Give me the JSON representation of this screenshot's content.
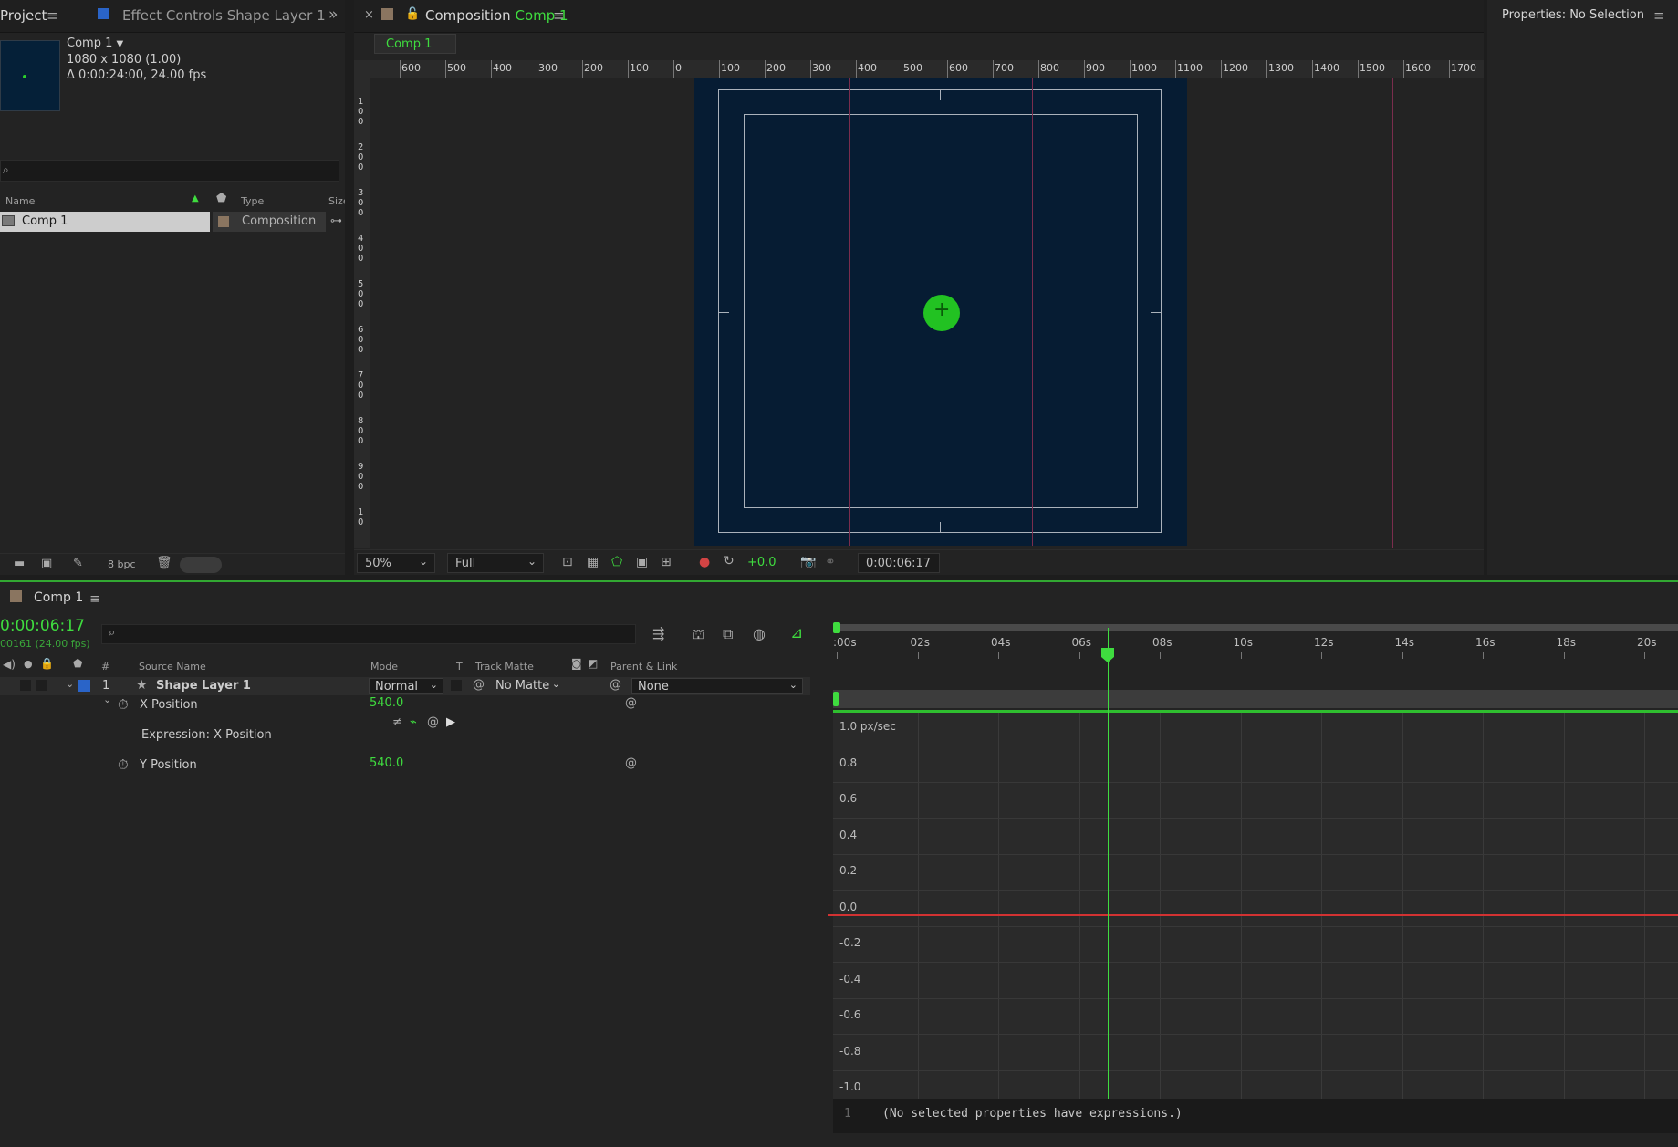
{
  "project_panel": {
    "tab_project": "Project",
    "tab_effect_controls": "Effect Controls Shape Layer 1",
    "comp_name": "Comp 1",
    "comp_res": "1080 x 1080 (1.00)",
    "comp_duration": "Δ 0:00:24:00, 24.00 fps",
    "col_name": "Name",
    "col_type": "Type",
    "col_size": "Size",
    "item_name": "Comp 1",
    "item_type": "Composition",
    "bpc": "8 bpc"
  },
  "comp_viewer": {
    "tab_label": "Composition",
    "tab_comp": "Comp 1",
    "chip_label": "Comp 1",
    "ruler_labels": [
      "600",
      "500",
      "400",
      "300",
      "200",
      "100",
      "0",
      "100",
      "200",
      "300",
      "400",
      "500",
      "600",
      "700",
      "800",
      "900",
      "1000",
      "1100",
      "1200",
      "1300",
      "1400",
      "1500",
      "1600",
      "1700"
    ],
    "vruler_labels": [
      "1 0 0",
      "2 0 0",
      "3 0 0",
      "4 0 0",
      "5 0 0",
      "6 0 0",
      "7 0 0",
      "8 0 0",
      "9 0 0",
      "1 0"
    ],
    "zoom": "50%",
    "resolution": "Full",
    "exposure": "+0.0",
    "timecode": "0:00:06:17"
  },
  "properties": {
    "title": "Properties: No Selection"
  },
  "timeline": {
    "tab_label": "Comp 1",
    "timecode": "0:00:06:17",
    "fps": "00161 (24.00 fps)",
    "headers": {
      "hash": "#",
      "source_name": "Source Name",
      "mode": "Mode",
      "t": "T",
      "track_matte": "Track Matte",
      "parent": "Parent & Link"
    },
    "layer": {
      "index": "1",
      "name": "Shape Layer 1",
      "mode": "Normal",
      "matte": "No Matte",
      "parent": "None"
    },
    "x_position": {
      "label": "X Position",
      "value": "540.0"
    },
    "expression_label": "Expression: X Position",
    "y_position": {
      "label": "Y Position",
      "value": "540.0"
    },
    "time_labels": [
      ":00s",
      "02s",
      "04s",
      "06s",
      "08s",
      "10s",
      "12s",
      "14s",
      "16s",
      "18s",
      "20s"
    ],
    "y_labels": [
      "1.0 px/sec",
      "0.8",
      "0.6",
      "0.4",
      "0.2",
      "0.0",
      "-0.2",
      "-0.4",
      "-0.6",
      "-0.8",
      "-1.0"
    ],
    "expr_line_number": "1",
    "expr_text": "(No selected properties have expressions.)"
  },
  "colors": {
    "accent_green": "#3fdc3f",
    "comp_bg": "#061c33",
    "zero_line": "#d23232"
  }
}
